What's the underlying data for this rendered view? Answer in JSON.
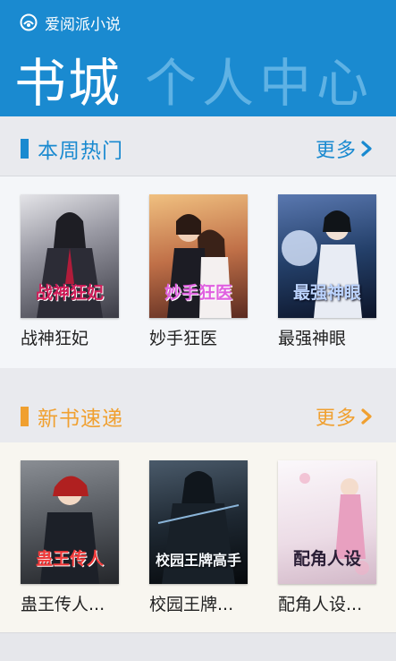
{
  "app": {
    "title": "爱阅派小说",
    "logo_icon": "book-logo-icon"
  },
  "tabs": [
    {
      "label": "书城",
      "active": true
    },
    {
      "label": "个人中心",
      "active": false
    }
  ],
  "sections": [
    {
      "title": "本周热门",
      "more_label": "更多",
      "accent": "#1a8ad0",
      "background": "#f4f6f9",
      "books": [
        {
          "label": "战神狂妃",
          "cover_text": "战神狂妃",
          "cover_colors": [
            "#d8d8dc",
            "#3a3a44"
          ],
          "cover_text_color": "#c2185b"
        },
        {
          "label": "妙手狂医",
          "cover_text": "妙手狂医",
          "cover_colors": [
            "#e0a66a",
            "#6a3322"
          ],
          "cover_text_color": "#d63fd2"
        },
        {
          "label": "最强神眼",
          "cover_text": "最强神眼",
          "cover_colors": [
            "#2f4a78",
            "#0e1a30"
          ],
          "cover_text_color": "#9ec3ff"
        }
      ]
    },
    {
      "title": "新书速递",
      "more_label": "更多",
      "accent": "#f0a030",
      "background": "#f8f6f0",
      "books": [
        {
          "label": "蛊王传人...",
          "cover_text": "蛊王传人",
          "cover_colors": [
            "#6a6e74",
            "#2a2d30"
          ],
          "cover_text_color": "#e83a3a"
        },
        {
          "label": "校园王牌...",
          "cover_text": "校园王牌高手",
          "cover_colors": [
            "#3a4a5a",
            "#0c1218"
          ],
          "cover_text_color": "#e8eef4"
        },
        {
          "label": "配角人设...",
          "cover_text": "配角人设",
          "cover_colors": [
            "#f6f0f4",
            "#d8c0d0"
          ],
          "cover_text_color": "#3a2a40"
        }
      ]
    }
  ]
}
